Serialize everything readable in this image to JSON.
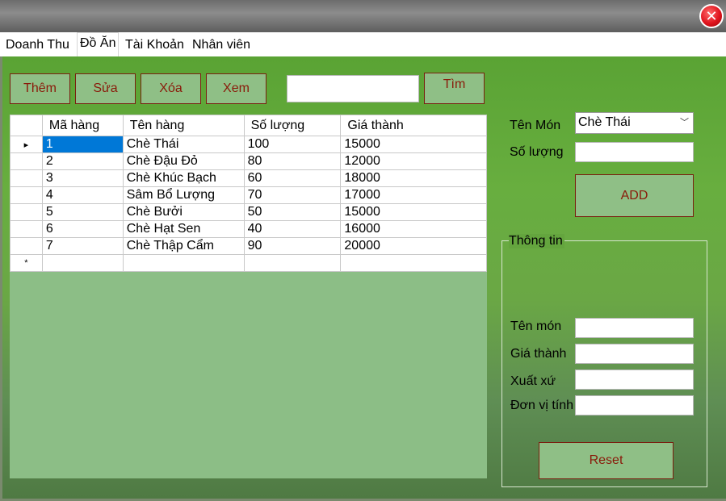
{
  "window": {
    "close_icon": "close-icon"
  },
  "tabs": [
    {
      "label": "Doanh Thu"
    },
    {
      "label": "Đồ Ăn"
    },
    {
      "label": "Tài Khoản"
    },
    {
      "label": "Nhân viên"
    }
  ],
  "toolbar": {
    "add_label": "Thêm",
    "edit_label": "Sửa",
    "delete_label": "Xóa",
    "view_label": "Xem",
    "search_value": "",
    "search_label": "Tìm"
  },
  "grid": {
    "columns": [
      "Mã hàng",
      "Tên hàng",
      "Số lượng",
      "Giá thành"
    ],
    "rows": [
      [
        "1",
        "Chè Thái",
        "100",
        "15000"
      ],
      [
        "2",
        "Chè Đậu Đỏ",
        "80",
        "12000"
      ],
      [
        "3",
        "Chè Khúc Bạch",
        "60",
        "18000"
      ],
      [
        "4",
        "Sâm Bổ Lượng",
        "70",
        "17000"
      ],
      [
        "5",
        "Chè Bưởi",
        "50",
        "15000"
      ],
      [
        "6",
        "Chè Hạt Sen",
        "40",
        "16000"
      ],
      [
        "7",
        "Chè Thập Cẩm",
        "90",
        "20000"
      ]
    ],
    "current_row_marker": "▸",
    "new_row_marker": "*"
  },
  "order_form": {
    "dish_label": "Tên Món",
    "dish_selected": "Chè Thái",
    "quantity_label": "Số lượng",
    "quantity_value": "",
    "add_button": "ADD"
  },
  "info": {
    "group_title": "Thông tin",
    "name_label": "Tên món",
    "price_label": "Giá thành",
    "origin_label": "Xuất xứ",
    "unit_label": "Đơn vị tính",
    "reset_button": "Reset"
  },
  "colors": {
    "panel_green": "#68ae3f",
    "button_face": "#8fbf86",
    "button_text": "#8a1a0a",
    "selection": "#0078d7"
  }
}
